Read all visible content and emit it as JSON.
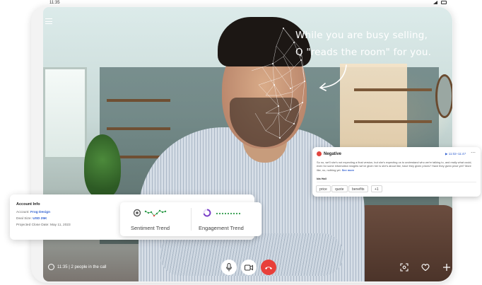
{
  "status_bar": {
    "time": "11:35"
  },
  "caption": {
    "line1": "While you are busy selling,",
    "line2": "Q \"reads the room\" for you."
  },
  "negative_card": {
    "label": "Negative",
    "timestamp": "▶ 11:02–11:47",
    "text": "So no, we'll she's not expecting a final version, but she's expecting us to understand who we're talking to, and really what could, even for some information insights we've given her is she's about like, have they given prices? Have they given price yet? More like, no, nothing yet.",
    "see_more": "See more",
    "speaker": "Ida Hall",
    "tags": [
      "price",
      "quote",
      "benefits",
      "+1"
    ]
  },
  "account": {
    "title": "Account Info",
    "account_label": "Account:",
    "account_value": "Frog Design",
    "deal_label": "Deal Size:",
    "deal_value": "USD 25K",
    "close_label": "Projected Close Date:",
    "close_value": "May 11, 2023"
  },
  "trends": {
    "sentiment_label": "Sentiment Trend",
    "engagement_label": "Engagement Trend"
  },
  "call": {
    "info": "11:35 | 2 people in the call"
  },
  "colors": {
    "negative": "#e2463f",
    "link": "#2f5fd0",
    "end_call": "#e8403a",
    "trend_green": "#2e9b4a",
    "engagement_ring": "#7a3fc8"
  },
  "icons": [
    "menu-icon",
    "chat-icon",
    "mic-icon",
    "camera-icon",
    "end-call-icon",
    "screen-focus-icon",
    "heart-icon",
    "plus-icon"
  ]
}
